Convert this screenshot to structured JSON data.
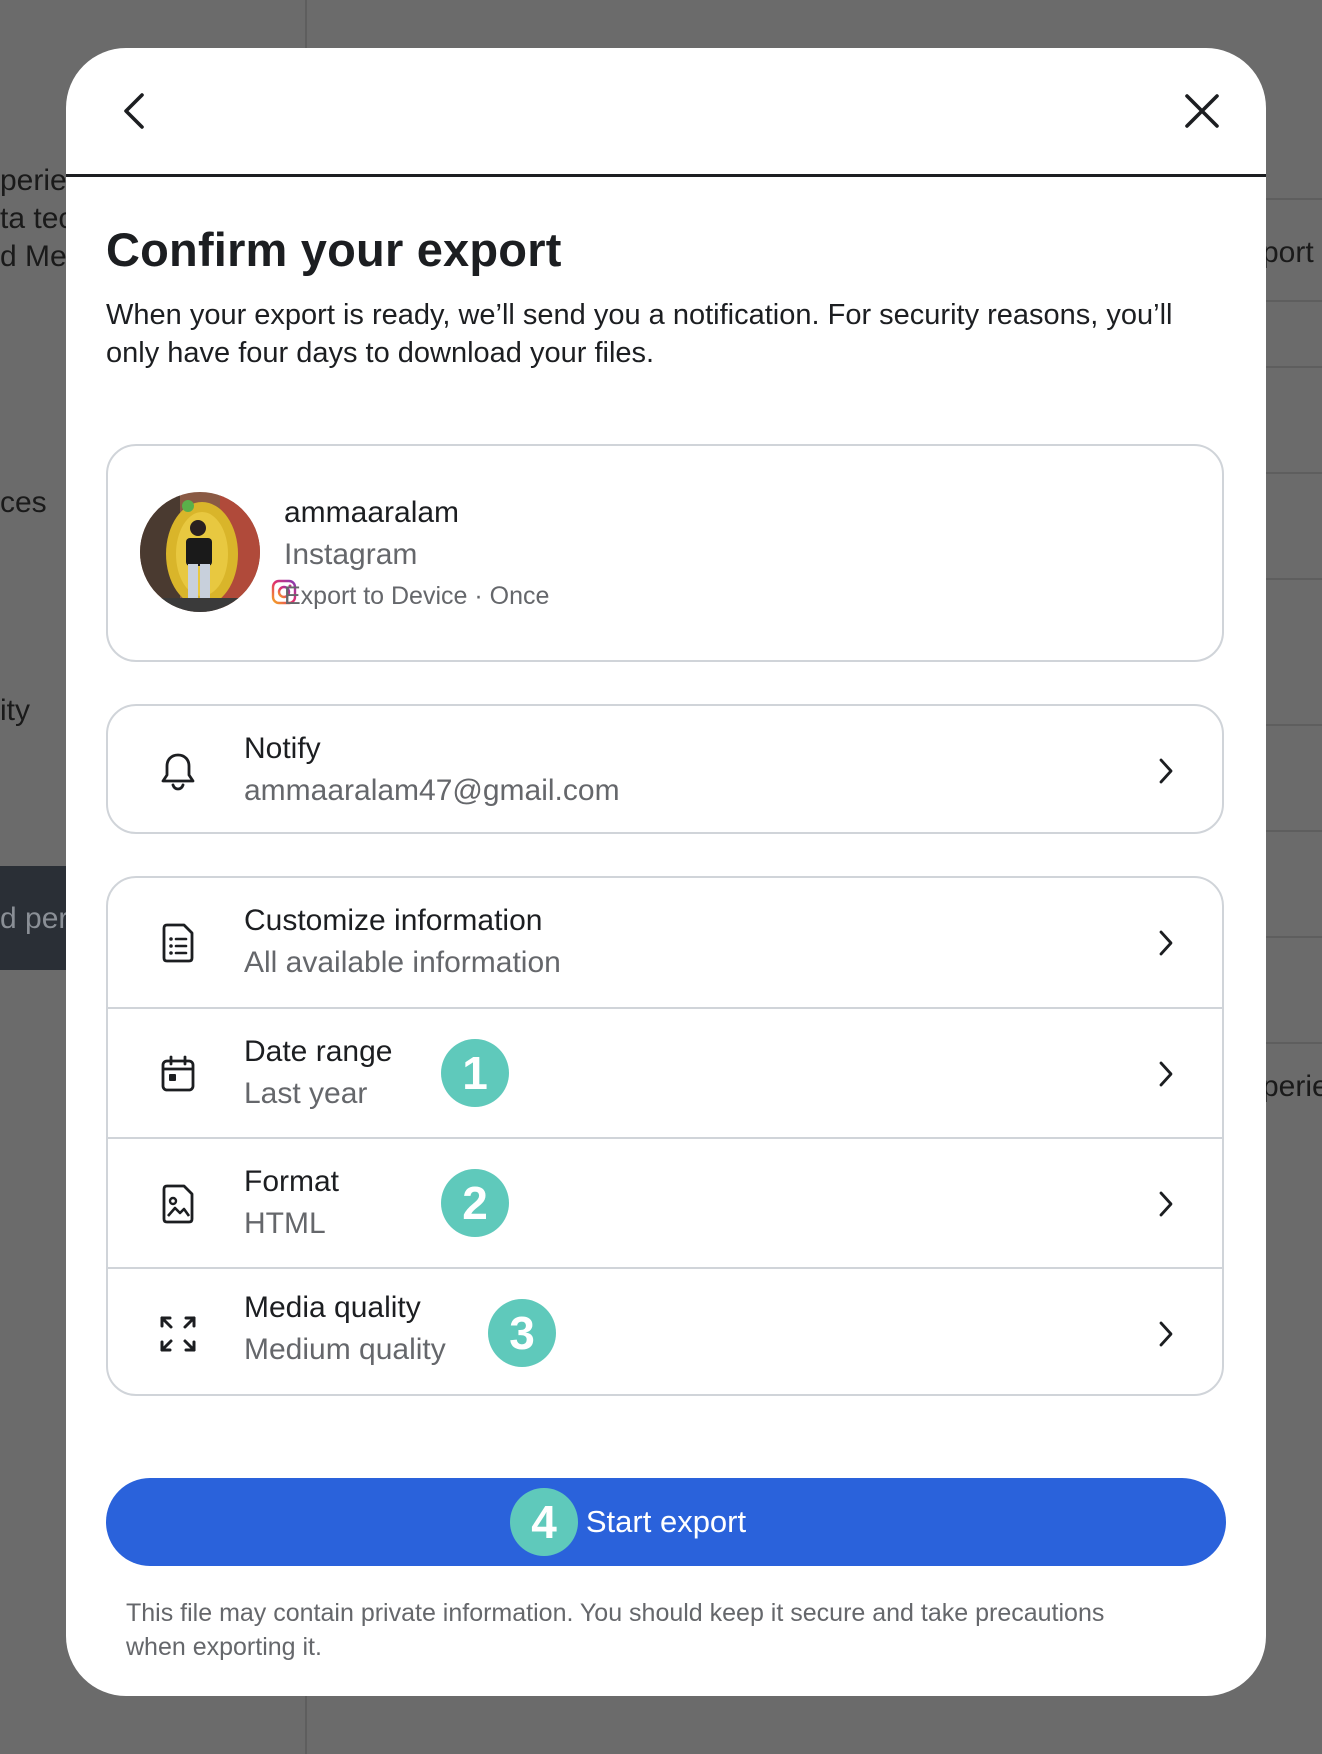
{
  "background": {
    "left_fragments": [
      "perien",
      "ta tec",
      "d Me",
      "ces",
      "ity",
      "d per"
    ],
    "right_fragments": [
      "port",
      "perie"
    ]
  },
  "modal": {
    "title": "Confirm your export",
    "subtitle": "When your export is ready, we’ll send you a notification. For security reasons, you’ll only have four days to download your files.",
    "account": {
      "username": "ammaaralam",
      "platform": "Instagram",
      "meta": "Export to Device · Once"
    },
    "notify": {
      "title": "Notify",
      "value": "ammaaralam47@gmail.com",
      "icon": "bell-icon"
    },
    "options": [
      {
        "title": "Customize information",
        "value": "All available information",
        "icon": "document-list-icon"
      },
      {
        "title": "Date range",
        "value": "Last year",
        "icon": "calendar-icon",
        "badge": "1"
      },
      {
        "title": "Format",
        "value": "HTML",
        "icon": "image-file-icon",
        "badge": "2"
      },
      {
        "title": "Media quality",
        "value": "Medium quality",
        "icon": "expand-arrows-icon",
        "badge": "3"
      }
    ],
    "start_button": {
      "label": "Start export",
      "badge": "4"
    },
    "footer_note": "This file may contain private information. You should keep it secure and take precautions when exporting it."
  },
  "colors": {
    "primary": "#2a62db",
    "badge": "#5fc9bb",
    "text": "#1c1e21",
    "secondary_text": "#65676b",
    "border": "#d0d4d9"
  }
}
